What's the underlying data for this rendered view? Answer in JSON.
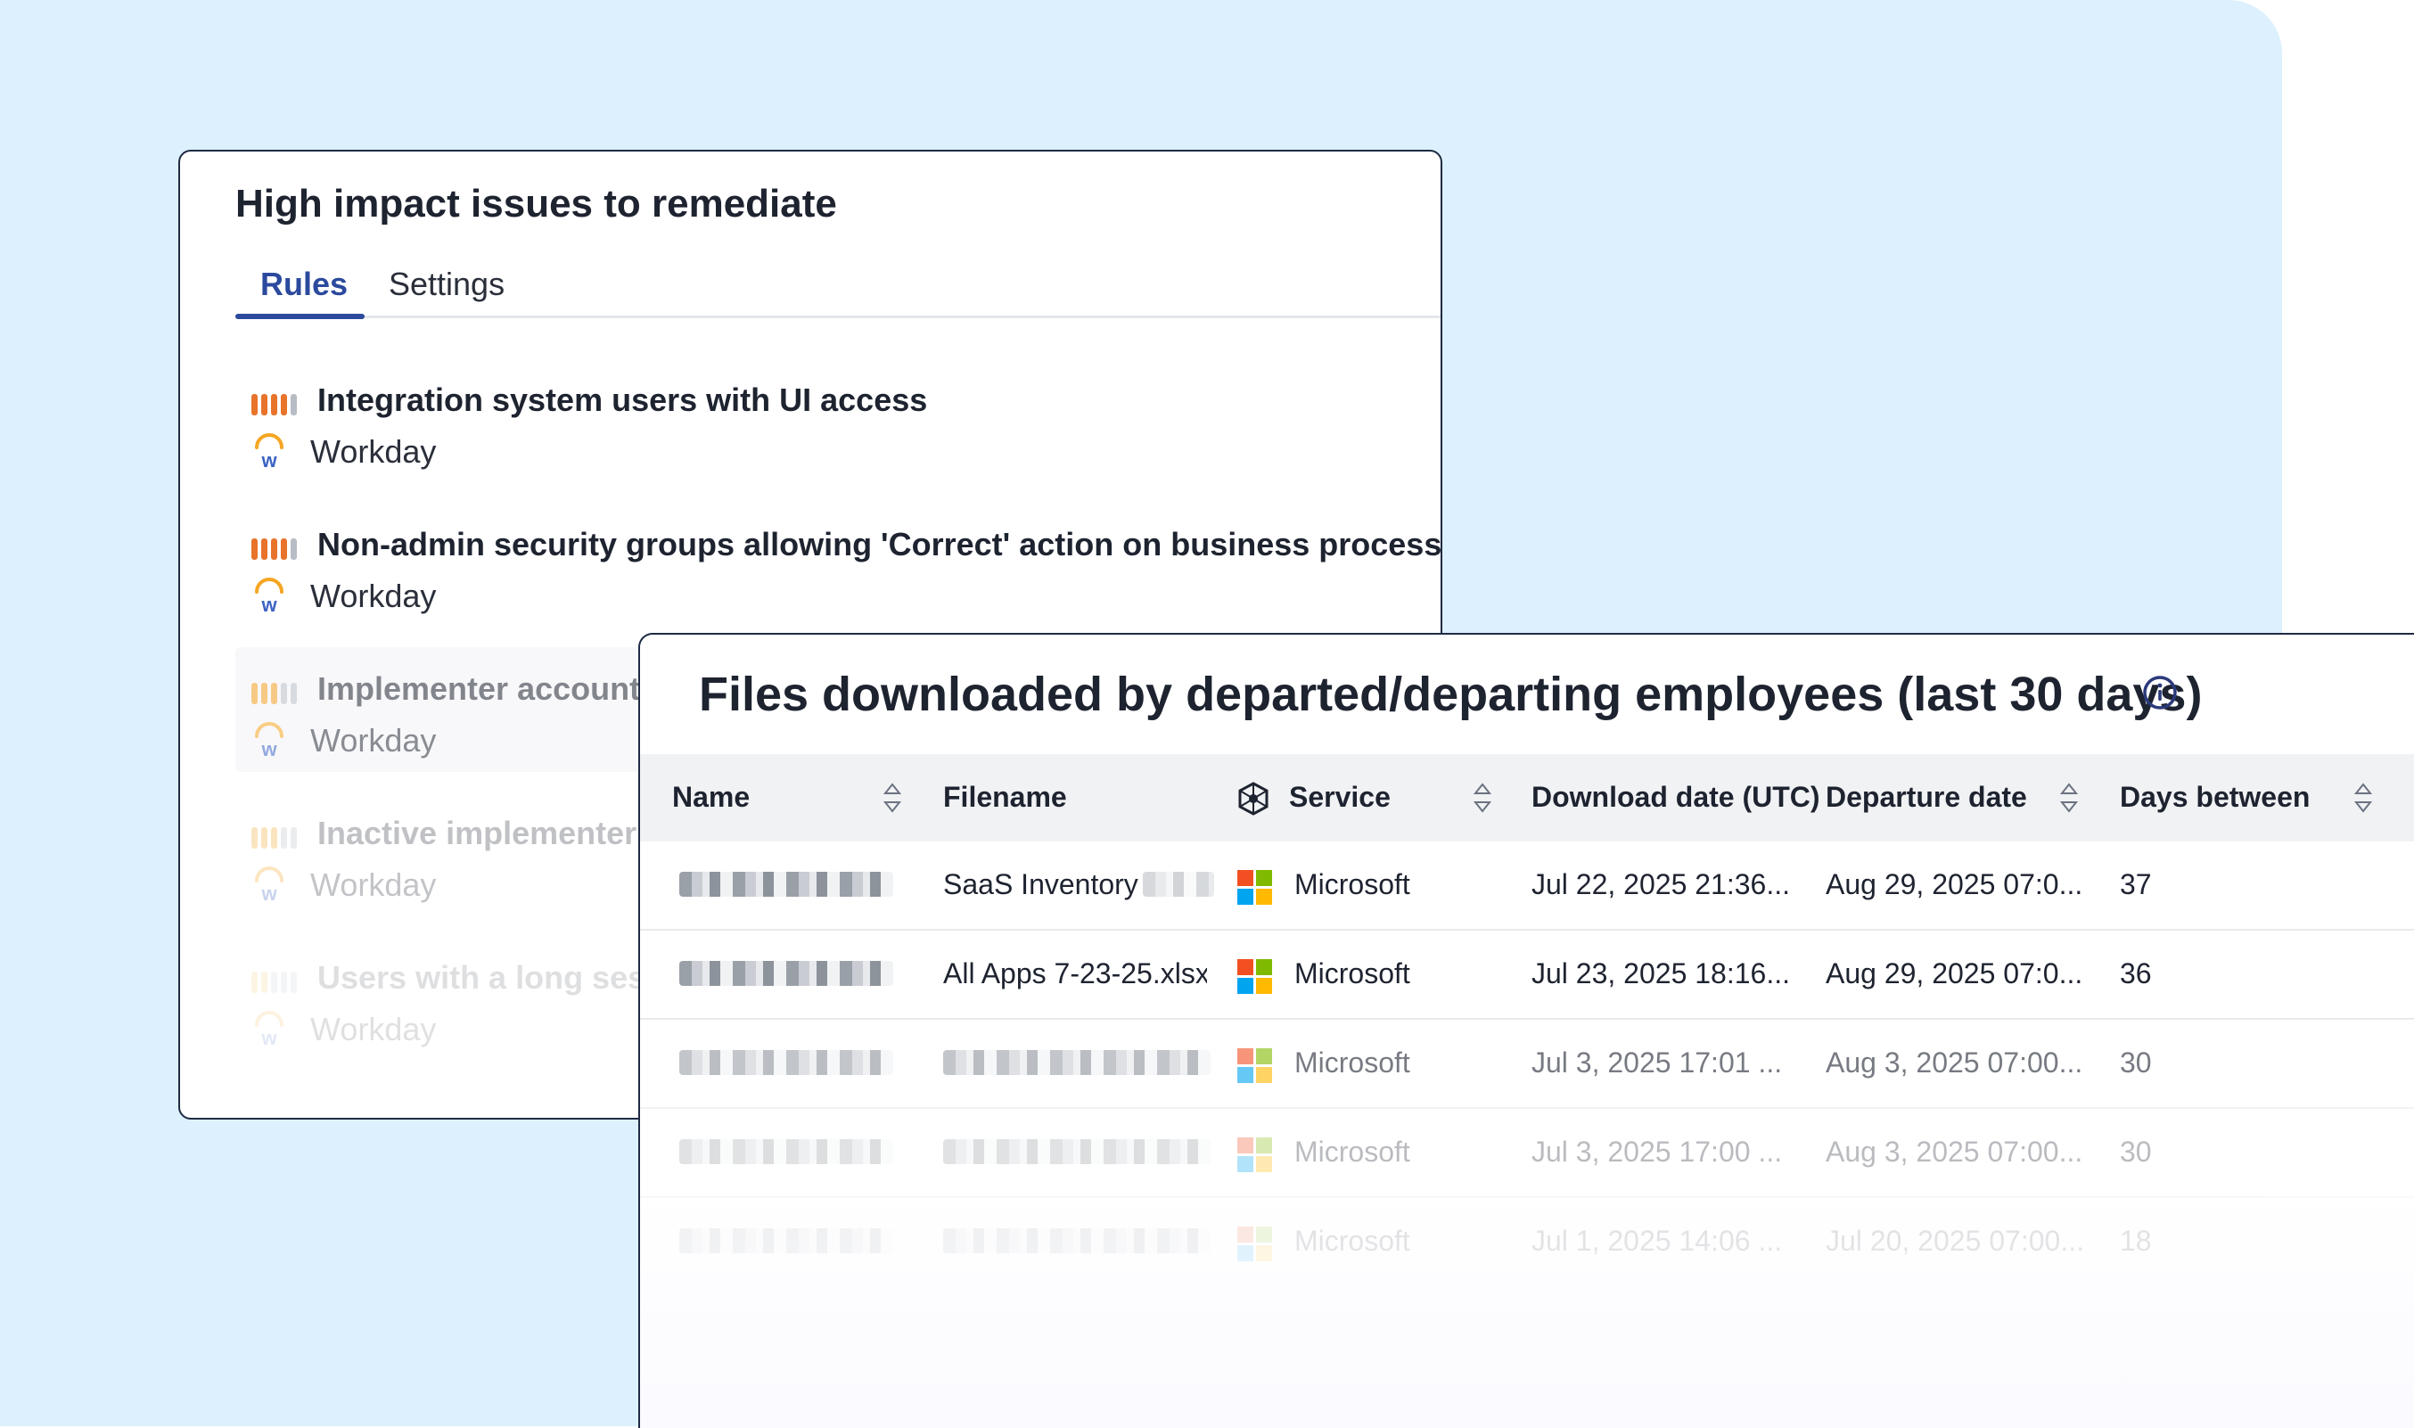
{
  "rules_card": {
    "title": "High impact issues to remediate",
    "tabs": [
      {
        "label": "Rules",
        "active": true
      },
      {
        "label": "Settings",
        "active": false
      }
    ],
    "rules": [
      {
        "title": "Integration system users with UI access",
        "app": "Workday"
      },
      {
        "title": "Non-admin security groups allowing 'Correct' action on business processes",
        "app": "Workday"
      },
      {
        "title": "Implementer accounts",
        "app": "Workday"
      },
      {
        "title": "Inactive implementer",
        "app": "Workday"
      },
      {
        "title": "Users with a long sess",
        "app": "Workday"
      }
    ],
    "severity_color": "#e8732a"
  },
  "files_card": {
    "title": "Files downloaded by departed/departing employees (last 30 days)",
    "columns": [
      "Name",
      "Filename",
      "Service",
      "Download date (UTC)",
      "Departure date",
      "Days between"
    ],
    "rows": [
      {
        "name": "",
        "filename": "SaaS Inventory",
        "service": "Microsoft",
        "download_date": "Jul 22, 2025 21:36...",
        "departure_date": "Aug 29, 2025 07:0...",
        "days_between": "37"
      },
      {
        "name": "",
        "filename": "All Apps 7-23-25.xlsx",
        "service": "Microsoft",
        "download_date": "Jul 23, 2025 18:16...",
        "departure_date": "Aug 29, 2025 07:0...",
        "days_between": "36"
      },
      {
        "name": "",
        "filename": "",
        "service": "Microsoft",
        "download_date": "Jul 3, 2025 17:01 ...",
        "departure_date": "Aug 3, 2025 07:00...",
        "days_between": "30"
      },
      {
        "name": "",
        "filename": "",
        "service": "Microsoft",
        "download_date": "Jul 3, 2025 17:00 ...",
        "departure_date": "Aug 3, 2025 07:00...",
        "days_between": "30"
      },
      {
        "name": "",
        "filename": "",
        "service": "Microsoft",
        "download_date": "Jul 1, 2025 14:06 ...",
        "departure_date": "Jul 20, 2025 07:00...",
        "days_between": "18"
      }
    ]
  },
  "icons": {
    "sort": "sort-arrows-icon",
    "info": "info-circle-icon",
    "service_header": "service-network-icon",
    "workday": "workday-logo-icon",
    "microsoft": "microsoft-logo-icon"
  },
  "colors": {
    "background": "#dcf1fd",
    "accent": "#2b4a9e",
    "severity": "#e8732a"
  }
}
